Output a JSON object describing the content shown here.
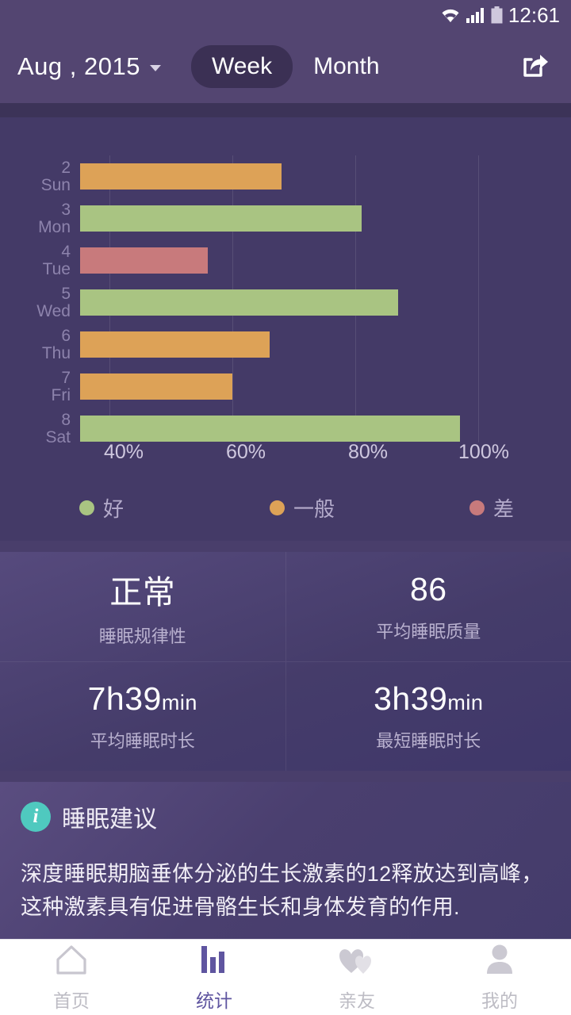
{
  "status_bar": {
    "time": "12:61",
    "icons": [
      "wifi-icon",
      "cellular-signal-icon",
      "battery-icon"
    ]
  },
  "header": {
    "month_label": "Aug , 2015",
    "dropdown_icon": "chevron-down-icon",
    "segments": [
      {
        "label": "Week",
        "active": true
      },
      {
        "label": "Month",
        "active": false
      }
    ],
    "share_icon": "share-icon"
  },
  "chart_data": {
    "type": "bar",
    "orientation": "horizontal",
    "title": "",
    "xlabel": "",
    "ylabel": "",
    "xlim": [
      35,
      103
    ],
    "grid": true,
    "xticks": [
      "40%",
      "60%",
      "80%",
      "100%"
    ],
    "xtick_values": [
      40,
      60,
      80,
      100
    ],
    "categories": [
      "2 Sun",
      "3 Mon",
      "4 Tue",
      "5 Wed",
      "6 Thu",
      "7 Fri",
      "8 Sat"
    ],
    "day_numbers": [
      "2",
      "3",
      "4",
      "5",
      "6",
      "7",
      "8"
    ],
    "day_names": [
      "Sun",
      "Mon",
      "Tue",
      "Wed",
      "Thu",
      "Fri",
      "Sat"
    ],
    "values": [
      68,
      81,
      56,
      87,
      66,
      60,
      97
    ],
    "bar_quality": [
      "average",
      "good",
      "poor",
      "good",
      "average",
      "average",
      "good"
    ],
    "colors": {
      "good": "#a9c482",
      "average": "#dda257",
      "poor": "#c87a7c"
    },
    "legend_position": "bottom",
    "legend": [
      {
        "label": "好",
        "quality": "good",
        "color": "#a9c482"
      },
      {
        "label": "一般",
        "quality": "average",
        "color": "#dda257"
      },
      {
        "label": "差",
        "quality": "poor",
        "color": "#c87a7c"
      }
    ]
  },
  "stats": [
    {
      "value": "正常",
      "unit": "",
      "label": "睡眠规律性"
    },
    {
      "value": "86",
      "unit": "",
      "label": "平均睡眠质量"
    },
    {
      "value": "7h39",
      "unit": "min",
      "label": "平均睡眠时长"
    },
    {
      "value": "3h39",
      "unit": "min",
      "label": "最短睡眠时长"
    }
  ],
  "advice": {
    "icon": "info-icon",
    "title": "睡眠建议",
    "body": "深度睡眠期脑垂体分泌的生长激素的12释放达到高峰，这种激素具有促进骨骼生长和身体发育的作用."
  },
  "bottom_nav": [
    {
      "label": "首页",
      "icon": "home-icon",
      "active": false
    },
    {
      "label": "统计",
      "icon": "bar-chart-icon",
      "active": true
    },
    {
      "label": "亲友",
      "icon": "hearts-icon",
      "active": false
    },
    {
      "label": "我的",
      "icon": "person-icon",
      "active": false
    }
  ],
  "theme": {
    "background": "#493e6b",
    "header_bg": "#534571",
    "chart_bg": "#443a67",
    "accent": "#5f55a0",
    "info_accent": "#4fc9bf"
  }
}
